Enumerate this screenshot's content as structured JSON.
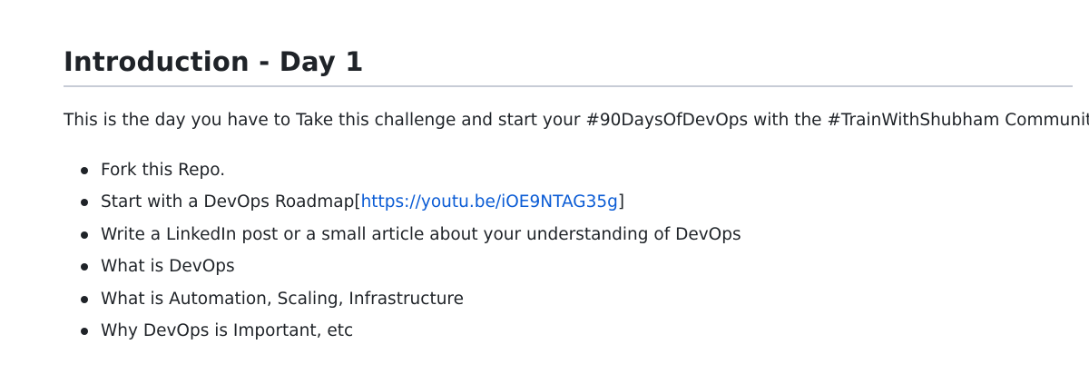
{
  "heading": "Introduction - Day 1",
  "intro": "This is the day you have to Take this challenge and start your #90DaysOfDevOps with the #TrainWithShubham Community",
  "items": [
    {
      "text": "Fork this Repo."
    },
    {
      "text": "Start with a DevOps Roadmap[",
      "link": "https://youtu.be/iOE9NTAG35g",
      "suffix": "]"
    },
    {
      "text": "Write a LinkedIn post or a small article about your understanding of DevOps"
    },
    {
      "text": "What is DevOps"
    },
    {
      "text": "What is Automation, Scaling, Infrastructure"
    },
    {
      "text": "Why DevOps is Important, etc"
    }
  ],
  "colors": {
    "text": "#1f2328",
    "link": "#0b5cd5",
    "rule": "#c7ccd6"
  }
}
